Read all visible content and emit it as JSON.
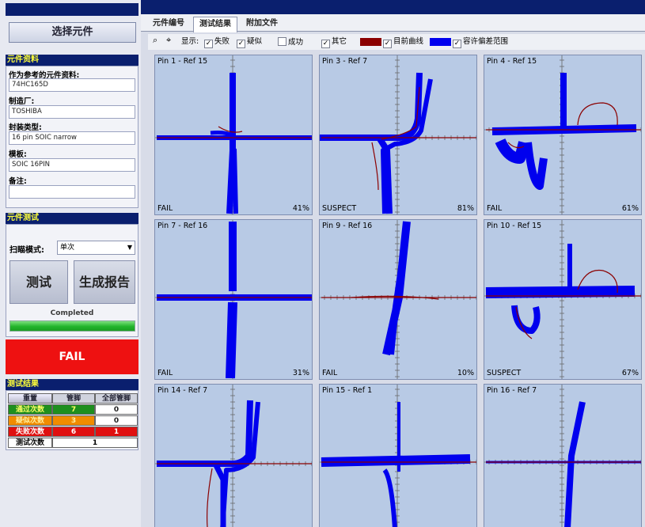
{
  "left": {
    "select_button": "选择元件",
    "info": {
      "title": "元件资料",
      "reference_label": "作为参考的元件资料:",
      "reference_value": "74HC165D",
      "maker_label": "制造厂:",
      "maker_value": "TOSHIBA",
      "package_label": "封装类型:",
      "package_value": "16 pin SOIC narrow",
      "template_label": "模板:",
      "template_value": "SOIC 16PIN",
      "notes_label": "备注:",
      "notes_value": ""
    },
    "test": {
      "title": "元件测试",
      "scan_mode_label": "扫瞄模式:",
      "scan_mode_value": "单次",
      "test_button": "测试",
      "report_button": "生成报告",
      "status_text": "Completed",
      "progress": 1.0
    },
    "result_banner": "FAIL",
    "results": {
      "title": "测试结果",
      "reset_label": "重置",
      "col_pins": "管脚",
      "col_all_pins": "全部管脚",
      "rows": [
        {
          "label": "通过次数",
          "pins": "7",
          "all": "0",
          "label_bg": "#1e8f1e",
          "pins_bg": "#1e8f1e",
          "text": "#ffff66"
        },
        {
          "label": "疑似次数",
          "pins": "3",
          "all": "0",
          "label_bg": "#f08c00",
          "pins_bg": "#f08c00",
          "text": "#fff0a0"
        },
        {
          "label": "失败次数",
          "pins": "6",
          "all": "1",
          "label_bg": "#e01010",
          "pins_bg": "#e01010",
          "text": "#ffffff"
        }
      ],
      "total_label": "测试次数",
      "total_value": "1"
    }
  },
  "tabs": [
    {
      "label": "元件编号",
      "active": false
    },
    {
      "label": "测试结果",
      "active": true
    },
    {
      "label": "附加文件",
      "active": false
    }
  ],
  "toolbar": {
    "display_label": "显示:",
    "fail_label": "失败",
    "suspect_label": "疑似",
    "pass_label": "成功",
    "other_label": "其它",
    "current_curve_label": "目前曲线",
    "tolerance_label": "容许偏差范围",
    "current_curve_color": "#8b0000",
    "tolerance_color": "#0000ee"
  },
  "plots": [
    {
      "title": "Pin 1 - Ref 15",
      "status": "FAIL",
      "percent": "41%",
      "shape": "crossA"
    },
    {
      "title": "Pin 3 - Ref 7",
      "status": "SUSPECT",
      "percent": "81%",
      "shape": "s"
    },
    {
      "title": "Pin 4 - Ref 15",
      "status": "FAIL",
      "percent": "61%",
      "shape": "loop"
    },
    {
      "title": "Pin 7 - Ref 16",
      "status": "FAIL",
      "percent": "31%",
      "shape": "crossB"
    },
    {
      "title": "Pin 9 - Ref 16",
      "status": "FAIL",
      "percent": "10%",
      "shape": "diag"
    },
    {
      "title": "Pin 10 - Ref 15",
      "status": "SUSPECT",
      "percent": "67%",
      "shape": "loop2"
    },
    {
      "title": "Pin 14 - Ref 7",
      "status": "",
      "percent": "",
      "shape": "s2"
    },
    {
      "title": "Pin 15 - Ref 1",
      "status": "",
      "percent": "",
      "shape": "wide"
    },
    {
      "title": "Pin 16 - Ref 7",
      "status": "",
      "percent": "",
      "shape": "cross2"
    }
  ]
}
